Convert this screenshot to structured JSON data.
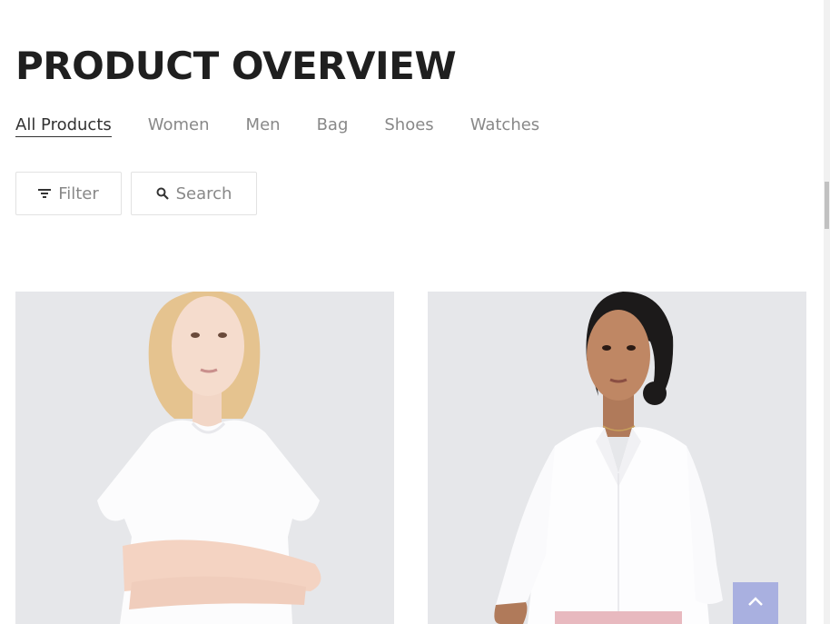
{
  "header": {
    "title": "PRODUCT OVERVIEW"
  },
  "tabs": [
    {
      "label": "All Products",
      "active": true
    },
    {
      "label": "Women",
      "active": false
    },
    {
      "label": "Men",
      "active": false
    },
    {
      "label": "Bag",
      "active": false
    },
    {
      "label": "Shoes",
      "active": false
    },
    {
      "label": "Watches",
      "active": false
    }
  ],
  "toolbar": {
    "filter_label": "Filter",
    "filter_icon": "filter-icon",
    "search_label": "Search",
    "search_icon": "search-icon"
  },
  "products": [
    {
      "image": "woman-white-tshirt-photo"
    },
    {
      "image": "woman-white-shirt-photo"
    }
  ],
  "scroll_top": {
    "icon": "chevron-up-icon"
  },
  "colors": {
    "title": "#1f1f1f",
    "tab_active": "#333333",
    "tab_inactive": "#888888",
    "scroll_top_bg": "#a9b0e0",
    "image_bg": "#e6e7ea"
  }
}
